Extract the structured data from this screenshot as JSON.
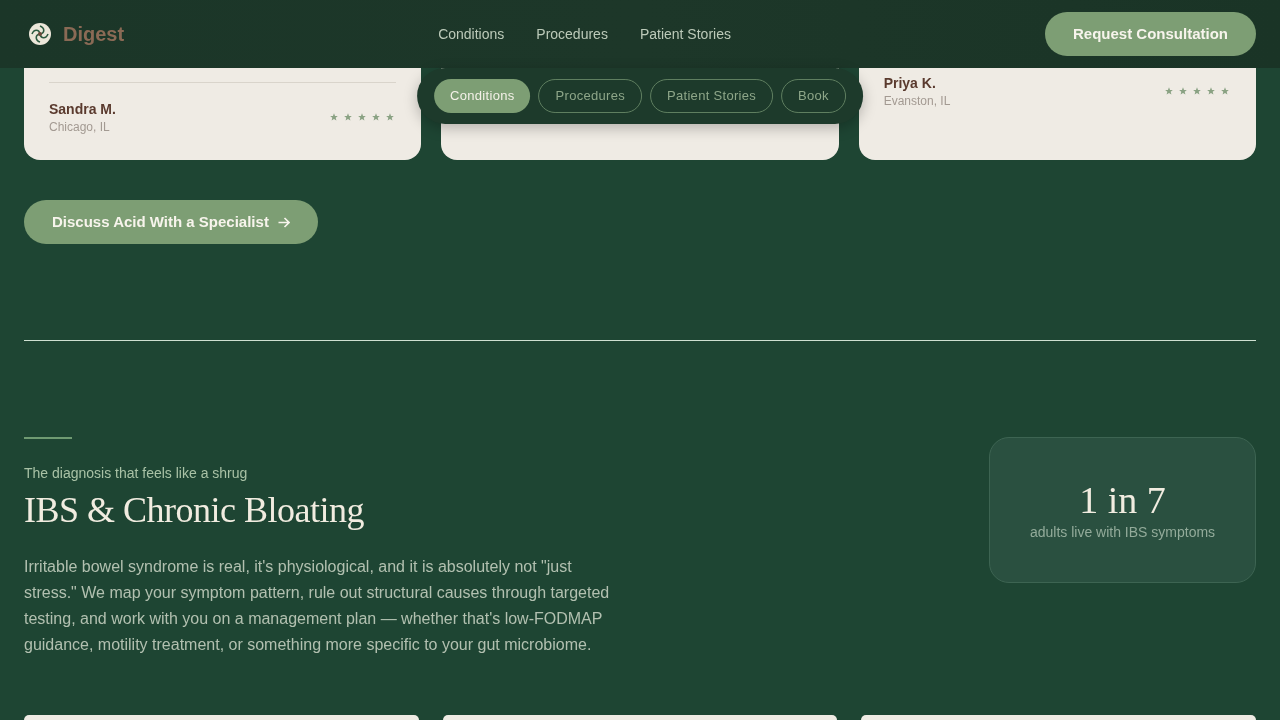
{
  "header": {
    "logo_text": "Digest",
    "nav": [
      "Conditions",
      "Procedures",
      "Patient Stories"
    ],
    "cta": "Request Consultation"
  },
  "pill_nav": [
    {
      "label": "Conditions",
      "selected": true
    },
    {
      "label": "Procedures",
      "selected": false
    },
    {
      "label": "Patient Stories",
      "selected": false
    },
    {
      "label": "Book",
      "selected": false
    }
  ],
  "testimonials": [
    {
      "kind": "review",
      "name": "Sandra M.",
      "location": "Chicago, IL",
      "stars": 5,
      "divider": true
    },
    {
      "kind": "covered"
    },
    {
      "kind": "review",
      "name": "Priya K.",
      "location": "Evanston, IL",
      "stars": 5,
      "divider": false
    }
  ],
  "cta_button": "Discuss Acid With a Specialist",
  "section": {
    "eyebrow": "The diagnosis that feels like a shrug",
    "heading": "IBS & Chronic Bloating",
    "body": "Irritable bowel syndrome is real, it's physiological, and it is absolutely not \"just stress.\" We map your symptom pattern, rule out structural causes through targeted testing, and work with you on a management plan — whether that's low-FODMAP guidance, motility treatment, or something more specific to your gut microbiome.",
    "stat": {
      "value": "1 in 7",
      "label": "adults live with IBS symptoms"
    }
  }
}
